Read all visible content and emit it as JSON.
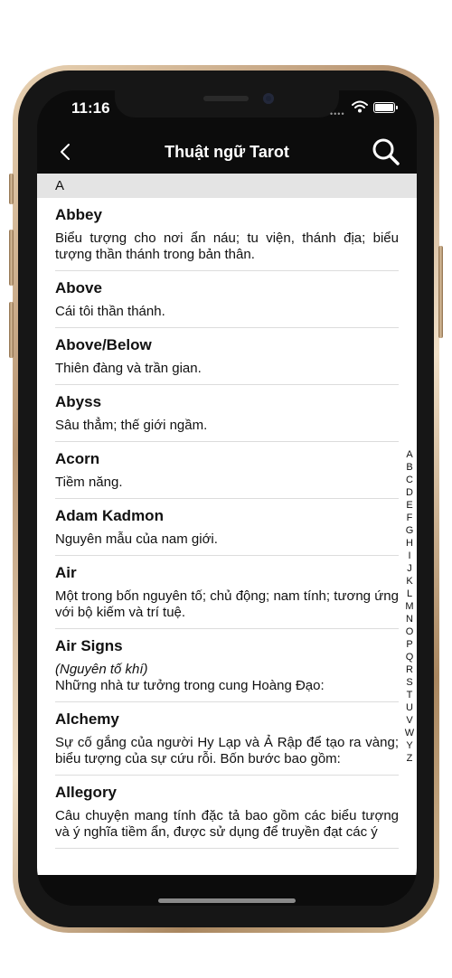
{
  "status_bar": {
    "time": "11:16",
    "signal": "••••"
  },
  "nav": {
    "title": "Thuật ngữ Tarot"
  },
  "section": {
    "header": "A"
  },
  "entries": [
    {
      "term": "Abbey",
      "definition": "Biểu tượng cho nơi ẩn náu; tu viện, thánh địa; biểu tượng thần thánh trong bản thân."
    },
    {
      "term": "Above",
      "definition": "Cái tôi thần thánh."
    },
    {
      "term": "Above/Below",
      "definition": "Thiên đàng và trần gian."
    },
    {
      "term": "Abyss",
      "definition": "Sâu thẳm; thế giới ngầm."
    },
    {
      "term": "Acorn",
      "definition": "Tiềm năng."
    },
    {
      "term": "Adam Kadmon",
      "definition": "Nguyên mẫu của nam giới."
    },
    {
      "term": "Air",
      "definition": "Một trong bốn nguyên tố; chủ động; nam tính; tương ứng với bộ kiếm và trí tuệ."
    },
    {
      "term": "Air Signs",
      "subtitle": "(Nguyên tố khí)",
      "definition": "Những nhà tư tưởng trong cung Hoàng Đạo:"
    },
    {
      "term": "Alchemy",
      "definition": "Sự cố gắng của người Hy Lạp và Ả Rập để tạo ra vàng; biểu tượng của sự cứu rỗi. Bốn bước bao gồm:"
    },
    {
      "term": "Allegory",
      "definition": "Câu chuyện mang tính đặc tả bao gồm các biểu tượng và ý nghĩa tiềm ẩn, được sử dụng để truyền đạt các ý"
    }
  ],
  "index_letters": [
    "A",
    "B",
    "C",
    "D",
    "E",
    "F",
    "G",
    "H",
    "I",
    "J",
    "K",
    "L",
    "M",
    "N",
    "O",
    "P",
    "Q",
    "R",
    "S",
    "T",
    "U",
    "V",
    "W",
    "Y",
    "Z"
  ],
  "icons": {
    "back": "chevron-left-icon",
    "search": "magnifier-icon",
    "wifi": "wifi-icon",
    "battery": "battery-icon"
  }
}
